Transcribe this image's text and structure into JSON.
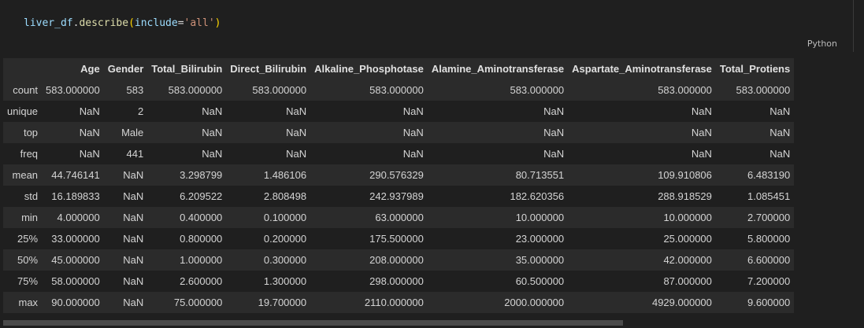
{
  "cell": {
    "code_tokens": [
      "liver_df",
      ".",
      "describe",
      "(",
      "include",
      "=",
      "'all'",
      ")"
    ],
    "language_label": "Python"
  },
  "table": {
    "columns": [
      "",
      "Age",
      "Gender",
      "Total_Bilirubin",
      "Direct_Bilirubin",
      "Alkaline_Phosphotase",
      "Alamine_Aminotransferase",
      "Aspartate_Aminotransferase",
      "Total_Protiens"
    ],
    "rows": [
      {
        "label": "count",
        "cells": [
          "583.000000",
          "583",
          "583.000000",
          "583.000000",
          "583.000000",
          "583.000000",
          "583.000000",
          "583.000000"
        ]
      },
      {
        "label": "unique",
        "cells": [
          "NaN",
          "2",
          "NaN",
          "NaN",
          "NaN",
          "NaN",
          "NaN",
          "NaN"
        ]
      },
      {
        "label": "top",
        "cells": [
          "NaN",
          "Male",
          "NaN",
          "NaN",
          "NaN",
          "NaN",
          "NaN",
          "NaN"
        ]
      },
      {
        "label": "freq",
        "cells": [
          "NaN",
          "441",
          "NaN",
          "NaN",
          "NaN",
          "NaN",
          "NaN",
          "NaN"
        ]
      },
      {
        "label": "mean",
        "cells": [
          "44.746141",
          "NaN",
          "3.298799",
          "1.486106",
          "290.576329",
          "80.713551",
          "109.910806",
          "6.483190"
        ]
      },
      {
        "label": "std",
        "cells": [
          "16.189833",
          "NaN",
          "6.209522",
          "2.808498",
          "242.937989",
          "182.620356",
          "288.918529",
          "1.085451"
        ]
      },
      {
        "label": "min",
        "cells": [
          "4.000000",
          "NaN",
          "0.400000",
          "0.100000",
          "63.000000",
          "10.000000",
          "10.000000",
          "2.700000"
        ]
      },
      {
        "label": "25%",
        "cells": [
          "33.000000",
          "NaN",
          "0.800000",
          "0.200000",
          "175.500000",
          "23.000000",
          "25.000000",
          "5.800000"
        ]
      },
      {
        "label": "50%",
        "cells": [
          "45.000000",
          "NaN",
          "1.000000",
          "0.300000",
          "208.000000",
          "35.000000",
          "42.000000",
          "6.600000"
        ]
      },
      {
        "label": "75%",
        "cells": [
          "58.000000",
          "NaN",
          "2.600000",
          "1.300000",
          "298.000000",
          "60.500000",
          "87.000000",
          "7.200000"
        ]
      },
      {
        "label": "max",
        "cells": [
          "90.000000",
          "NaN",
          "75.000000",
          "19.700000",
          "2110.000000",
          "2000.000000",
          "4929.000000",
          "9.600000"
        ]
      }
    ]
  }
}
